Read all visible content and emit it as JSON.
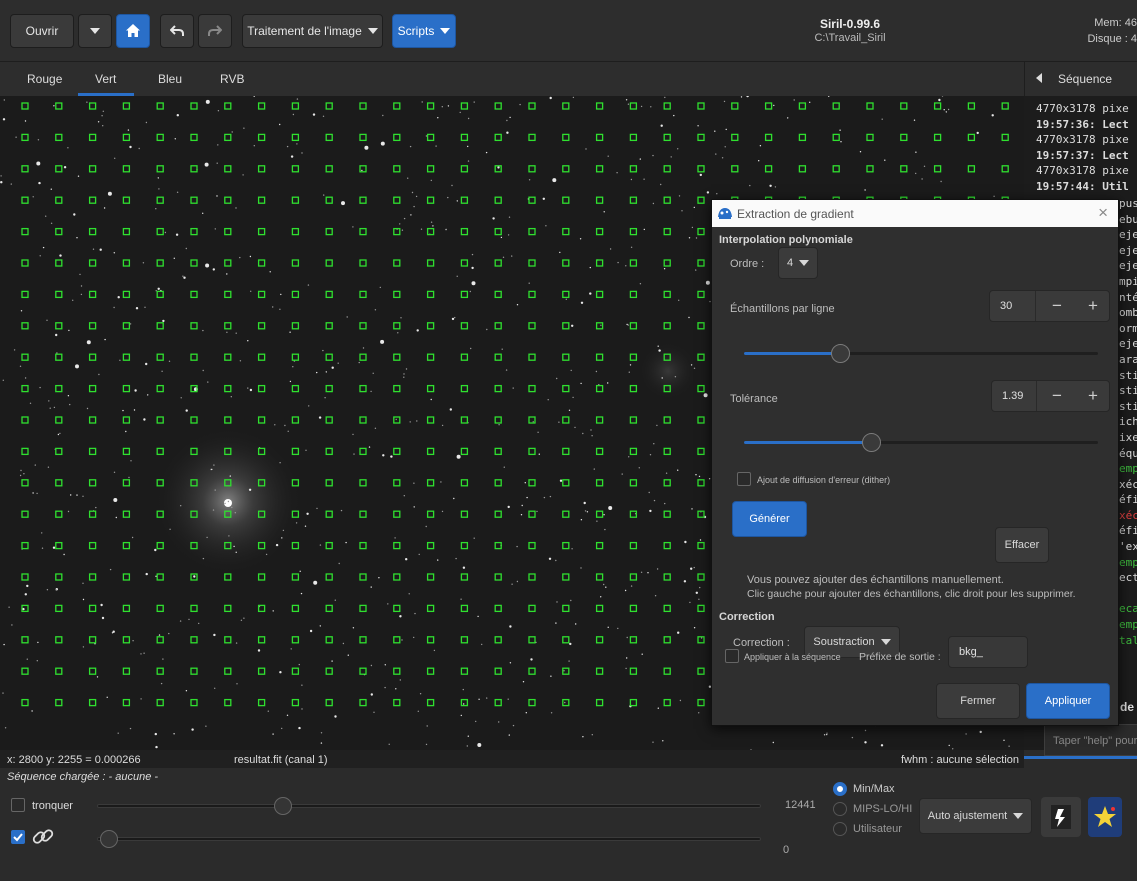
{
  "toolbar": {
    "open_label": "Ouvrir",
    "image_processing_label": "Traitement de l'image",
    "scripts_label": "Scripts"
  },
  "app": {
    "title": "Siril-0.99.6",
    "path": "C:\\Travail_Siril",
    "mem": "Mem: 46",
    "disk": "Disque : 4"
  },
  "tabs": [
    "Rouge",
    "Vert",
    "Bleu",
    "RVB"
  ],
  "sequence_tab_label": "Séquence",
  "console": {
    "lines": [
      {
        "text": "4770x3178 pixe",
        "color": "#dcdcdc",
        "bold": false
      },
      {
        "text": "19:57:36: Lect",
        "color": "#dcdcdc",
        "bold": true
      },
      {
        "text": "4770x3178 pixe",
        "color": "#dcdcdc",
        "bold": false
      },
      {
        "text": "19:57:37: Lect",
        "color": "#dcdcdc",
        "bold": true
      },
      {
        "text": "4770x3178 pixe",
        "color": "#dcdcdc",
        "bold": false
      },
      {
        "text": "19:57:44: Util",
        "color": "#dcdcdc",
        "bold": true
      },
      {
        "text": "",
        "color": "#dcdcdc",
        "bold": false
      },
      {
        "text": "",
        "color": "#dcdcdc",
        "bold": false
      },
      {
        "text": "",
        "color": "#dcdcdc",
        "bold": false
      },
      {
        "text": "",
        "color": "#dcdcdc",
        "bold": false
      },
      {
        "text": "",
        "color": "#dcdcdc",
        "bold": false
      },
      {
        "text": "",
        "color": "#dcdcdc",
        "bold": false
      },
      {
        "text": "",
        "color": "#dcdcdc",
        "bold": false
      },
      {
        "text": "",
        "color": "#dcdcdc",
        "bold": false
      },
      {
        "text": "",
        "color": "#dcdcdc",
        "bold": false
      },
      {
        "text": "",
        "color": "#dcdcdc",
        "bold": false
      },
      {
        "text": "",
        "color": "#dcdcdc",
        "bold": false
      },
      {
        "text": "",
        "color": "#dcdcdc",
        "bold": false
      },
      {
        "text": "",
        "color": "#dcdcdc",
        "bold": false
      },
      {
        "text": "",
        "color": "#dcdcdc",
        "bold": false
      },
      {
        "text": "",
        "color": "#dcdcdc",
        "bold": false
      },
      {
        "text": "",
        "color": "#dcdcdc",
        "bold": false
      },
      {
        "text": "",
        "color": "#dcdcdc",
        "bold": false
      },
      {
        "text": "",
        "color": "#dcdcdc",
        "bold": false
      },
      {
        "text": "",
        "color": "#dcdcdc",
        "bold": false
      },
      {
        "text": "",
        "color": "#dcdcdc",
        "bold": false
      },
      {
        "text": "",
        "color": "#dcdcdc",
        "bold": false
      },
      {
        "text": "",
        "color": "#dcdcdc",
        "bold": false
      },
      {
        "text": "",
        "color": "#dcdcdc",
        "bold": false
      },
      {
        "text": "",
        "color": "#dcdcdc",
        "bold": false
      },
      {
        "text": "",
        "color": "#dcdcdc",
        "bold": false
      },
      {
        "text": "",
        "color": "#dcdcdc",
        "bold": false
      },
      {
        "text": "",
        "color": "#dcdcdc",
        "bold": false
      },
      {
        "text": "",
        "color": "#dcdcdc",
        "bold": false
      },
      {
        "text": "",
        "color": "#dcdcdc",
        "bold": false
      },
      {
        "text": "",
        "color": "#dcdcdc",
        "bold": false
      },
      {
        "text": "",
        "color": "#dcdcdc",
        "bold": false
      },
      {
        "text": "",
        "color": "#dcdcdc",
        "bold": false
      },
      {
        "text": "",
        "color": "#dcdcdc",
        "bold": false
      },
      {
        "text": "",
        "color": "#dcdcdc",
        "bold": false
      },
      {
        "text": "",
        "color": "#dcdcdc",
        "bold": false
      }
    ],
    "visible_tail": [
      {
        "text": "pus",
        "color": "#dcdcdc"
      },
      {
        "text": "ebu",
        "color": "#dcdcdc"
      },
      {
        "text": "eje",
        "color": "#dcdcdc"
      },
      {
        "text": "eje",
        "color": "#dcdcdc"
      },
      {
        "text": "eje",
        "color": "#dcdcdc"
      },
      {
        "text": "mpi",
        "color": "#dcdcdc"
      },
      {
        "text": "nté",
        "color": "#dcdcdc"
      },
      {
        "text": "ombi",
        "color": "#dcdcdc"
      },
      {
        "text": "orm",
        "color": "#dcdcdc"
      },
      {
        "text": "eje",
        "color": "#dcdcdc"
      },
      {
        "text": "ara",
        "color": "#dcdcdc"
      },
      {
        "text": "sti",
        "color": "#dcdcdc"
      },
      {
        "text": "sti",
        "color": "#dcdcdc"
      },
      {
        "text": "sti",
        "color": "#dcdcdc"
      },
      {
        "text": "ich",
        "color": "#dcdcdc"
      },
      {
        "text": "ixe",
        "color": "#dcdcdc"
      },
      {
        "text": "équ",
        "color": "#dcdcdc"
      },
      {
        "text": "emp",
        "color": "#3fbf3f"
      },
      {
        "text": "xéc",
        "color": "#dcdcdc"
      },
      {
        "text": "éfi",
        "color": "#dcdcdc"
      },
      {
        "text": "xéc",
        "color": "#e04040"
      },
      {
        "text": "éfi",
        "color": "#dcdcdc"
      },
      {
        "text": "'ex",
        "color": "#dcdcdc"
      },
      {
        "text": "emp",
        "color": "#3fbf3f"
      },
      {
        "text": "ect",
        "color": "#dcdcdc"
      },
      {
        "text": "",
        "color": "#dcdcdc"
      },
      {
        "text": "eca",
        "color": "#3fbf3f"
      },
      {
        "text": "emp",
        "color": "#3fbf3f"
      },
      {
        "text": "tal",
        "color": "#3fbf3f"
      }
    ],
    "partial_label": "de",
    "input_placeholder": "Taper \"help\" pour"
  },
  "dialog": {
    "title": "Extraction de gradient",
    "section_poly": "Interpolation polynomiale",
    "order_label": "Ordre :",
    "order_value": "4",
    "samples_label": "Échantillons par ligne",
    "samples_value": "30",
    "samples_slider_fraction": 0.27,
    "tolerance_label": "Tolérance",
    "tolerance_value": "1.39",
    "tolerance_slider_fraction": 0.36,
    "dither_label": "Ajout de diffusion d'erreur (dither)",
    "generate_label": "Générer",
    "clear_label": "Effacer",
    "help_line1": "Vous pouvez ajouter des échantillons manuellement.",
    "help_line2": "Clic gauche pour ajouter des échantillons, clic droit pour les supprimer.",
    "section_correction": "Correction",
    "correction_label": "Correction :",
    "correction_value": "Soustraction",
    "apply_seq_label": "Appliquer à la séquence",
    "prefix_label": "Préfixe de sortie :",
    "prefix_value": "bkg_",
    "close_label": "Fermer",
    "apply_label": "Appliquer",
    "minus": "−",
    "plus": "+"
  },
  "status": {
    "coords": "x: 2800 y: 2255 = 0.000266",
    "filename": "resultat.fit (canal 1)",
    "fwhm": "fwhm : aucune sélection",
    "sequence": "Séquence chargée : - aucune -"
  },
  "bottom": {
    "crop_label": "tronquer",
    "hi_value": "12441",
    "lo_value": "0",
    "hi_slider_fraction": 0.28,
    "lo_slider_fraction": 0.0,
    "radio_options": [
      "Min/Max",
      "MIPS-LO/HI",
      "Utilisateur"
    ],
    "selected_radio": 0,
    "auto_label": "Auto ajustement"
  },
  "colors": {
    "accent": "#2a6fc8",
    "sample_box": "#2fe02f"
  }
}
